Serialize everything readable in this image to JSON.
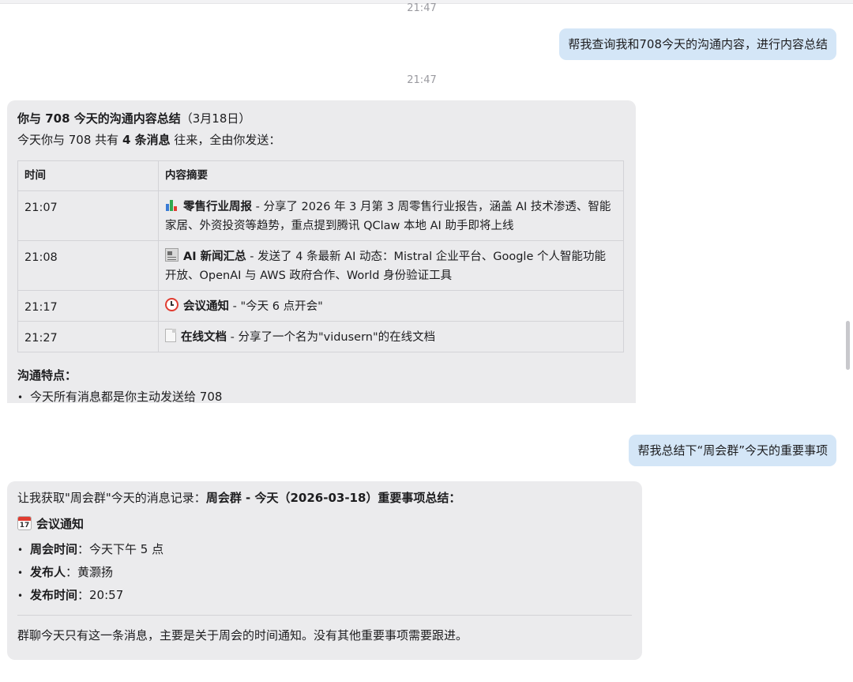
{
  "timestamps": [
    "21:47",
    "21:47"
  ],
  "messages": {
    "user1": "帮我查询我和708今天的沟通内容，进行内容总结",
    "bot1": {
      "title_bold": "你与 708 今天的沟通内容总结",
      "title_date": "（3月18日）",
      "intro_pre": "今天你与 708 共有 ",
      "intro_bold": "4 条消息",
      "intro_post": " 往来，全由你发送：",
      "table": {
        "headers": [
          "时间",
          "内容摘要"
        ],
        "rows": [
          {
            "time": "21:07",
            "icon": "bar-chart-icon",
            "title": "零售行业周报",
            "desc": " - 分享了 2026 年 3 月第 3 周零售行业报告，涵盖 AI 技术渗透、智能家居、外资投资等趋势，重点提到腾讯 QClaw 本地 AI 助手即将上线"
          },
          {
            "time": "21:08",
            "icon": "newspaper-icon",
            "title": "AI 新闻汇总",
            "desc": " - 发送了 4 条最新 AI 动态：Mistral 企业平台、Google 个人智能功能开放、OpenAI 与 AWS 政府合作、World 身份验证工具"
          },
          {
            "time": "21:17",
            "icon": "alarm-clock-icon",
            "title": "会议通知",
            "desc": " - \"今天 6 点开会\""
          },
          {
            "time": "21:27",
            "icon": "document-icon",
            "title": "在线文档",
            "desc": " - 分享了一个名为\"vidusern\"的在线文档"
          }
        ]
      },
      "features_title": "沟通特点：",
      "features": [
        "今天所有消息都是你主动发送给 708"
      ]
    },
    "user2": "帮我总结下“周会群”今天的重要事项",
    "bot2": {
      "intro_pre": "让我获取\"周会群\"今天的消息记录：",
      "intro_bold": "周会群 - 今天（2026-03-18）重要事项总结：",
      "section_icon": "calendar-icon",
      "section_icon_text": "17",
      "section_title": "会议通知",
      "items": [
        {
          "label": "周会时间",
          "value": "：今天下午 5 点"
        },
        {
          "label": "发布人",
          "value": "：黄灏扬"
        },
        {
          "label": "发布时间",
          "value": "：20:57"
        }
      ],
      "footer": "群聊今天只有这一条消息，主要是关于周会的时间通知。没有其他重要事项需要跟进。"
    }
  },
  "colors": {
    "user_bubble": "#d4e6f7",
    "bot_bubble": "#ebebed",
    "timestamp": "#9a9aa0"
  }
}
